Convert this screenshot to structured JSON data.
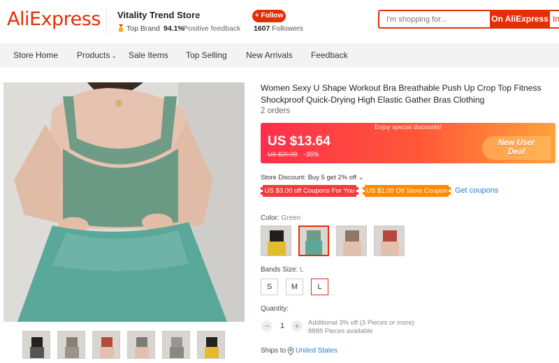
{
  "header": {
    "logo": "AliExpress",
    "store_name": "Vitality Trend Store",
    "top_brand": "Top Brand",
    "feedback_pct": "94.1%",
    "feedback_label": "Positive feedback",
    "follow_label": "+ Follow",
    "followers_count": "1607",
    "followers_label": "Followers",
    "search_placeholder": "I'm shopping for...",
    "search_aliexpress": "On AliExpress",
    "search_in": "In",
    "brand_color": "#e62e04"
  },
  "nav": {
    "items": [
      {
        "label": "Store Home"
      },
      {
        "label": "Products"
      },
      {
        "label": "Sale Items"
      },
      {
        "label": "Top Selling"
      },
      {
        "label": "New Arrivals"
      },
      {
        "label": "Feedback"
      }
    ]
  },
  "gallery": {
    "thumbs": [
      {
        "icon": "thumb-black-top"
      },
      {
        "icon": "thumb-grey-top"
      },
      {
        "icon": "thumb-red-top"
      },
      {
        "icon": "thumb-grey-back"
      },
      {
        "icon": "thumb-grey-side"
      },
      {
        "icon": "thumb-yellow-top"
      }
    ]
  },
  "product": {
    "title": "Women Sexy U Shape Workout Bra Breathable Push Up Crop Top Fitness Shockproof Quick-Drying High Elastic Gather Bras Clothing",
    "orders": "2 orders"
  },
  "price": {
    "promo": "Enjoy special discounts!",
    "current": "US $13.64",
    "original": "US $20.99",
    "discount": "-35%",
    "deal_line1": "New User",
    "deal_line2": "Deal"
  },
  "discounts": {
    "store_discount": "Store Discount: Buy 5 get 2% off",
    "coupon1": "US $3.00 off Coupons For You",
    "coupon2": "US $1.00 Off Store Coupon",
    "get_coupons": "Get coupons"
  },
  "options": {
    "color_label": "Color:",
    "color_value": "Green",
    "colors": [
      "Black/Yellow",
      "Green",
      "Khaki",
      "Red"
    ],
    "size_label": "Bands Size:",
    "size_value": "L",
    "sizes": [
      "S",
      "M",
      "L"
    ]
  },
  "quantity": {
    "label": "Quantity:",
    "value": "1",
    "minus": "−",
    "plus": "+",
    "note1": "Additional 3% off (3 Pieces or more)",
    "note2": "8888 Pieces available"
  },
  "shipping": {
    "label": "Ships to",
    "country": "United States"
  }
}
